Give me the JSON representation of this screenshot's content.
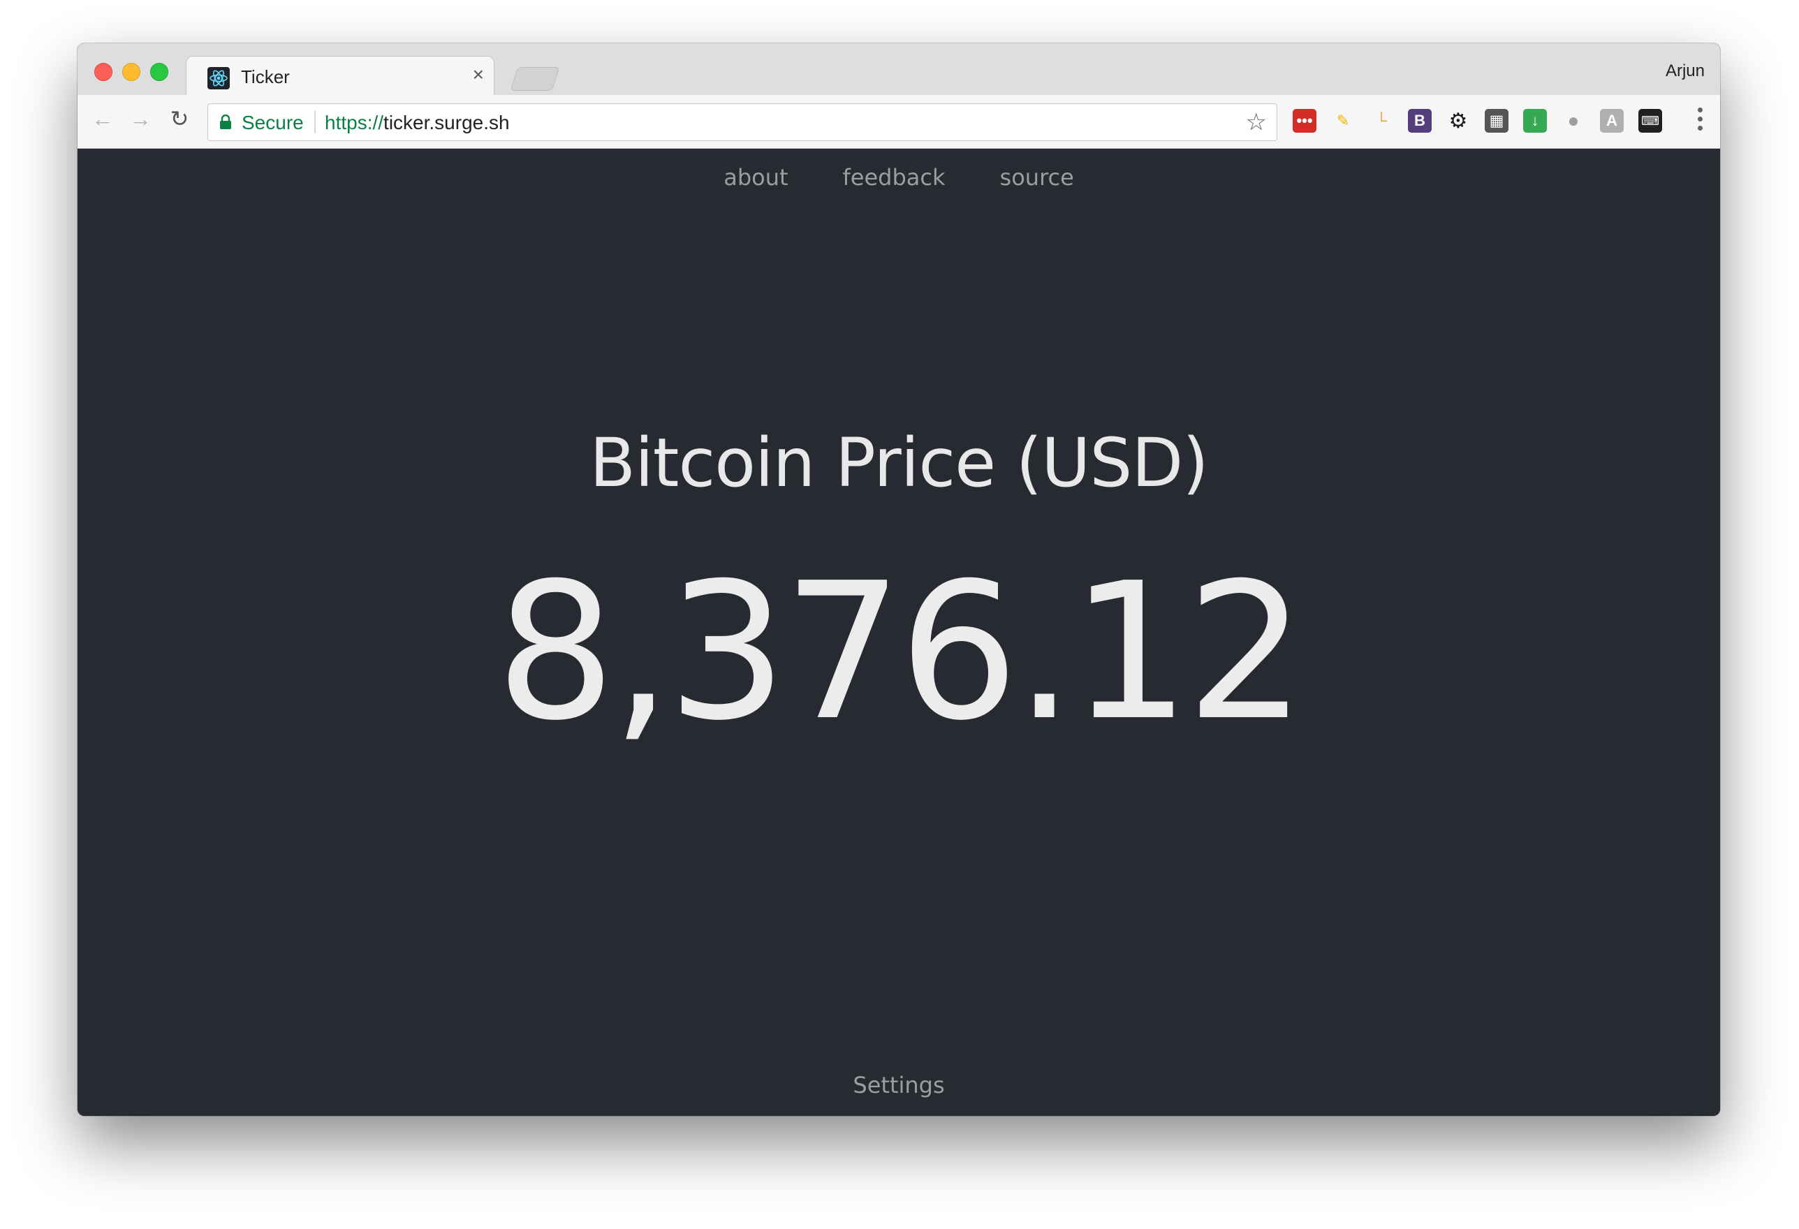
{
  "browser": {
    "tab": {
      "title": "Ticker",
      "close_label": "×",
      "favicon": "react-atom-icon"
    },
    "profile_name": "Arjun",
    "omnibox": {
      "security_label": "Secure",
      "url_scheme": "https://",
      "url_host": "ticker.surge.sh"
    },
    "extensions": [
      {
        "name": "lastpass-extension-icon",
        "color": "#d32d27"
      },
      {
        "name": "pencil-extension-icon",
        "color": "#f4b400"
      },
      {
        "name": "ruler-extension-icon",
        "color": "#e8a33d"
      },
      {
        "name": "bootstrap-extension-icon",
        "color": "#563d7c"
      },
      {
        "name": "gear-extension-icon",
        "color": "#1a1a1a"
      },
      {
        "name": "film-extension-icon",
        "color": "#555555"
      },
      {
        "name": "download-extension-icon",
        "color": "#34a853"
      },
      {
        "name": "bulb-extension-icon",
        "color": "#9e9e9e"
      },
      {
        "name": "angular-extension-icon",
        "color": "#b0b0b0"
      },
      {
        "name": "keyboard-extension-icon",
        "color": "#202020"
      }
    ]
  },
  "page": {
    "nav": {
      "about": "about",
      "feedback": "feedback",
      "source": "source"
    },
    "heading": "Bitcoin Price (USD)",
    "price": "8,376.12",
    "settings": "Settings"
  },
  "colors": {
    "background": "#282a31",
    "text": "#ececec",
    "muted": "#9b9da1",
    "secure_green": "#0b8043"
  }
}
